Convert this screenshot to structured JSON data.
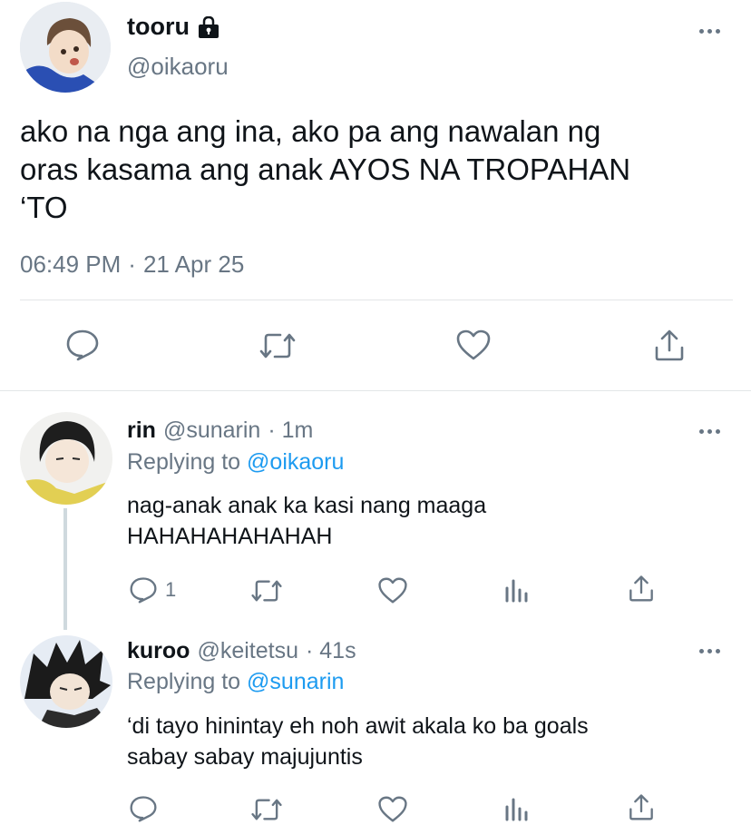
{
  "main_tweet": {
    "display_name": "tooru",
    "handle": "@oikaoru",
    "text_line1": "ako na nga ang ina, ako pa ang nawalan ng",
    "text_line2": "oras kasama ang anak AYOS NA TROPAHAN",
    "text_line3": "‘TO",
    "time": "06:49 PM",
    "separator": "·",
    "date": "21 Apr 25",
    "icons": [
      "reply-icon",
      "retweet-icon",
      "like-icon",
      "share-icon"
    ]
  },
  "replies": [
    {
      "display_name": "rin",
      "handle": "@sunarin",
      "time_ago": "· 1m",
      "replying_label": "Replying to",
      "replying_to": "@oikaoru",
      "text_line1": "nag-anak anak ka kasi nang maaga",
      "text_line2": "HAHAHAHAHAHAH",
      "reply_count": "1",
      "icons": [
        "reply-icon",
        "retweet-icon",
        "like-icon",
        "analytics-icon",
        "share-icon"
      ]
    },
    {
      "display_name": "kuroo",
      "handle": "@keitetsu",
      "time_ago": "· 41s",
      "replying_label": "Replying to",
      "replying_to": "@sunarin",
      "text_line1": "‘di tayo hinintay eh noh awit akala ko ba goals",
      "text_line2": "sabay sabay majujuntis",
      "reply_count": "",
      "icons": [
        "reply-icon",
        "retweet-icon",
        "like-icon",
        "analytics-icon",
        "share-icon"
      ]
    }
  ],
  "colors": {
    "accent": "#1d9bf0",
    "muted": "#687684",
    "divider": "#e3e6e8"
  }
}
